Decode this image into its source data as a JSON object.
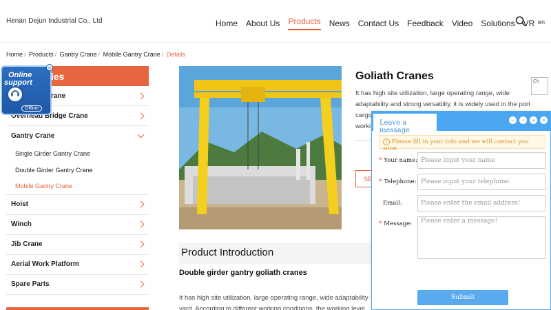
{
  "header": {
    "brand": "Henan Dejun Industrial Co., Ltd",
    "nav": [
      "Home",
      "About Us",
      "Products",
      "News",
      "Contact Us",
      "Feedback",
      "Video",
      "Solutions",
      "VR"
    ],
    "active_nav": "Products",
    "lang": "en"
  },
  "breadcrumb": {
    "items": [
      "Home",
      "Products",
      "Gantry Crane",
      "Mobile Gantry Crane"
    ],
    "current": "Details"
  },
  "sidebar": {
    "heading": "ies",
    "items": [
      {
        "label": "rane"
      },
      {
        "label": "Overhead Bridge Crane"
      },
      {
        "label": "Gantry Crane"
      },
      {
        "label": "Hoist"
      },
      {
        "label": "Winch"
      },
      {
        "label": "Jib Crane"
      },
      {
        "label": "Aerial Work Platform"
      },
      {
        "label": "Spare Parts"
      }
    ],
    "subitems": [
      "Single Girder Gantry Crane",
      "Double Girder Gantry Crane",
      "Mobile Gantry Crane"
    ],
    "active_sub": "Mobile Gantry Crane"
  },
  "online_support": {
    "line1": "Online",
    "line2": "support",
    "status": "Offline"
  },
  "product": {
    "title": "Goliath Cranes",
    "desc_lines": [
      "It has high site utilization, large operating range, wide",
      "adaptability and strong versatility, it is widely used in the port",
      "cargo",
      "worki"
    ],
    "see_label": "SE",
    "thumb_label": "Ch"
  },
  "intro": {
    "heading": "Product Introduction",
    "subheading": "Double girder gantry goliath cranes",
    "body_line1": "It has high site utilization, large operating range, wide adaptability",
    "body_line2": "yard. According to different working conditions, the working level"
  },
  "chat": {
    "tab": "Leave a message",
    "notice": "Please fill in your info and we will contact you soon.",
    "fields": [
      {
        "label": "Your name:",
        "required": true,
        "placeholder": "Please input your name"
      },
      {
        "label": "Telephone:",
        "required": true,
        "placeholder": "Please input your telephone."
      },
      {
        "label": "Email:",
        "required": false,
        "placeholder": "Please enter the email address!"
      },
      {
        "label": "Message:",
        "required": true,
        "placeholder": "Please enter a message!"
      }
    ],
    "submit": "Submit"
  },
  "colors": {
    "accent": "#e8623a",
    "sidebar_head": "#e8663f",
    "chat_blue": "#4aa6f0"
  }
}
